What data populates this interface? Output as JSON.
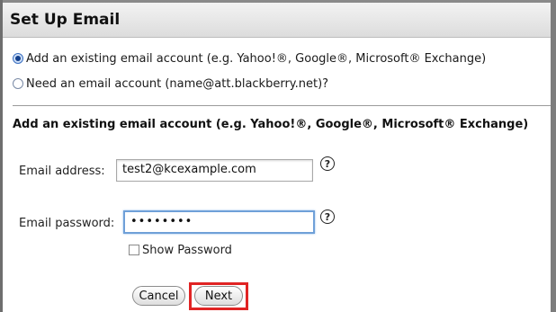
{
  "dialog": {
    "title": "Set Up Email"
  },
  "options": [
    {
      "label": "Add an existing email account (e.g. Yahoo!®, Google®, Microsoft® Exchange)",
      "checked": true
    },
    {
      "label": "Need an email account (name@att.blackberry.net)?",
      "checked": false
    }
  ],
  "section": {
    "heading": "Add an existing email account (e.g. Yahoo!®, Google®, Microsoft® Exchange)"
  },
  "form": {
    "email_label": "Email address:",
    "email_value": "test2@kcexample.com",
    "password_label": "Email password:",
    "password_value": "••••••••",
    "help_glyph": "?",
    "show_password_label": "Show Password",
    "show_password_checked": false
  },
  "buttons": {
    "cancel": "Cancel",
    "next": "Next"
  },
  "colors": {
    "highlight": "#e02424",
    "focus_ring": "#6fa0d8"
  }
}
